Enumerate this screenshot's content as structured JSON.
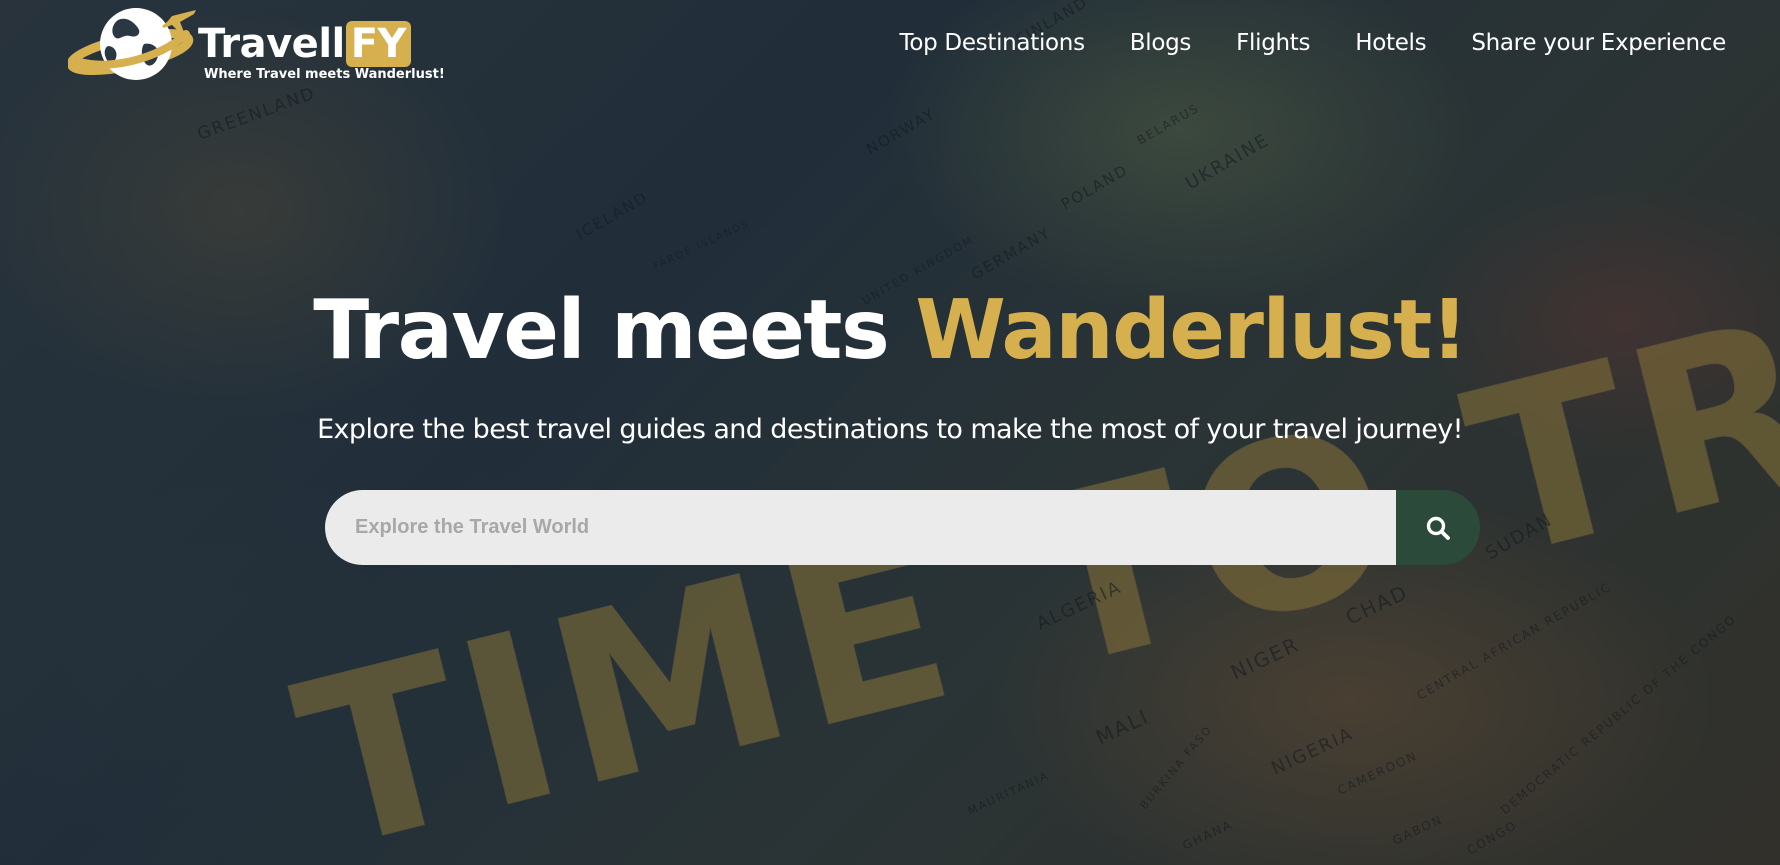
{
  "brand": {
    "name_main": "Travell",
    "name_highlight": "FY",
    "tagline": "Where Travel meets Wanderlust!"
  },
  "nav": {
    "items": [
      {
        "label": "Top Destinations"
      },
      {
        "label": "Blogs"
      },
      {
        "label": "Flights"
      },
      {
        "label": "Hotels"
      },
      {
        "label": "Share your Experience"
      }
    ]
  },
  "hero": {
    "title_part1": "Travel meets",
    "title_accent": "Wanderlust!",
    "subtitle": "Explore the best travel guides and destinations to make the most of your travel journey!",
    "background_text": "TIME TO TRAVEL",
    "map_labels": [
      "GREENLAND",
      "ICELAND",
      "FAROE ISLANDS",
      "NORWAY",
      "FINLAND",
      "POLAND",
      "BELARUS",
      "UKRAINE",
      "GERMANY",
      "UNITED KINGDOM",
      "ALGERIA",
      "NIGER",
      "CHAD",
      "SUDAN",
      "MALI",
      "NIGERIA",
      "MAURITANIA",
      "BURKINA FASO",
      "CAMEROON",
      "CENTRAL AFRICAN REPUBLIC",
      "DEMOCRATIC REPUBLIC OF THE CONGO",
      "GHANA",
      "GABON",
      "CONGO"
    ]
  },
  "search": {
    "placeholder": "Explore the Travel World",
    "value": "",
    "button_icon": "search-icon"
  },
  "colors": {
    "accent": "#d6b04e",
    "search_button": "#2c4a3a",
    "search_field": "#ebebeb",
    "text": "#ffffff"
  }
}
